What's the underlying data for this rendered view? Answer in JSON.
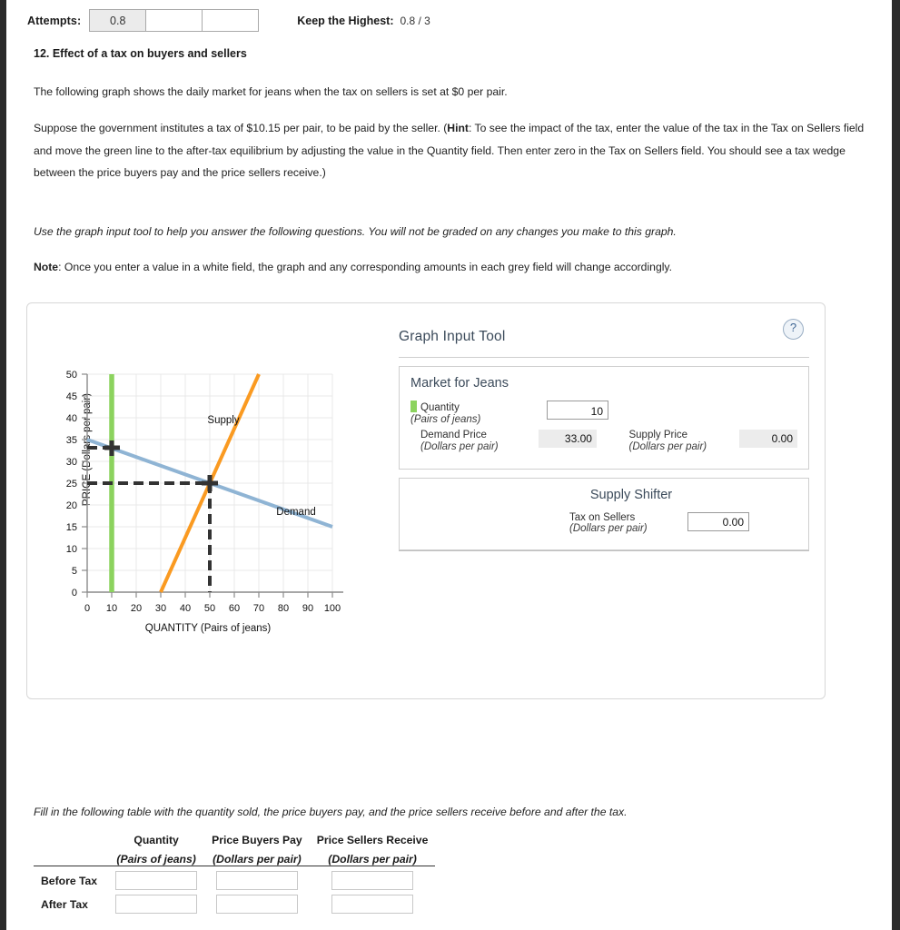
{
  "header": {
    "attempts_label": "Attempts:",
    "attempt_values": [
      "0.8",
      "",
      ""
    ],
    "keep_highest_label": "Keep the Highest:",
    "keep_highest_value": "0.8 / 3"
  },
  "question": {
    "number_title": "12. Effect of a tax on buyers and sellers",
    "p1": "The following graph shows the daily market for jeans when the tax on sellers is set at $0 per pair.",
    "p2_a": "Suppose the government institutes a tax of $10.15 per pair, to be paid by the seller. (",
    "p2_hint": "Hint",
    "p2_b": ": To see the impact of the tax, enter the value of the tax in the Tax on Sellers field and move the green line to the after-tax equilibrium by adjusting the value in the Quantity field. Then enter zero in the Tax on Sellers field. You should see a tax wedge between the price buyers pay and the price sellers receive.)",
    "p3": "Use the graph input tool to help you answer the following questions. You will not be graded on any changes you make to this graph.",
    "p4_note": "Note",
    "p4_rest": ": Once you enter a value in a white field, the graph and any corresponding amounts in each grey field will change accordingly."
  },
  "graph_tool": {
    "title": "Graph Input Tool",
    "help_glyph": "?",
    "market_section_title": "Market for Jeans",
    "quantity_label": "Quantity",
    "quantity_unit": "(Pairs of jeans)",
    "quantity_value": "10",
    "demand_price_label": "Demand Price",
    "demand_price_unit": "(Dollars per pair)",
    "demand_price_value": "33.00",
    "supply_price_label": "Supply Price",
    "supply_price_unit": "(Dollars per pair)",
    "supply_price_value": "0.00",
    "shifter_section_title": "Supply Shifter",
    "tax_label": "Tax on Sellers",
    "tax_unit": "(Dollars per pair)",
    "tax_value": "0.00",
    "swatch_color": "#8CD35E"
  },
  "chart_data": {
    "type": "line",
    "title": "",
    "xlabel": "QUANTITY (Pairs of jeans)",
    "ylabel": "PRICE (Dollars per pair)",
    "xlim": [
      0,
      100
    ],
    "ylim": [
      0,
      50
    ],
    "xticks": [
      0,
      10,
      20,
      30,
      40,
      50,
      60,
      70,
      80,
      90,
      100
    ],
    "yticks": [
      0,
      5,
      10,
      15,
      20,
      25,
      30,
      35,
      40,
      45,
      50
    ],
    "grid": true,
    "legend": "inline-labels",
    "series": [
      {
        "name": "Demand",
        "color": "#8FB4D4",
        "label": "Demand",
        "label_at": [
          78,
          20
        ],
        "points": [
          [
            0,
            35
          ],
          [
            100,
            15
          ]
        ]
      },
      {
        "name": "Supply",
        "color": "#FA9A21",
        "label": "Supply",
        "label_at": [
          47,
          41
        ],
        "points": [
          [
            30,
            0
          ],
          [
            70,
            50
          ]
        ]
      },
      {
        "name": "Quantity line",
        "color": "#8CD35E",
        "label": "",
        "points": [
          [
            10,
            0
          ],
          [
            10,
            50
          ]
        ]
      }
    ],
    "annotations": [
      {
        "type": "cross-marker",
        "at": [
          50,
          25
        ],
        "color": "#333333"
      },
      {
        "type": "cross-marker",
        "at": [
          10,
          33
        ],
        "color": "#333333"
      },
      {
        "type": "dashed-h",
        "from": [
          0,
          25
        ],
        "to": [
          50,
          25
        ],
        "color": "#333333"
      },
      {
        "type": "dashed-v",
        "from": [
          50,
          0
        ],
        "to": [
          50,
          25
        ],
        "color": "#333333"
      },
      {
        "type": "dashed-h",
        "from": [
          0,
          33
        ],
        "to": [
          10,
          33
        ],
        "color": "#333333"
      }
    ]
  },
  "table": {
    "intro": "Fill in the following table with the quantity sold, the price buyers pay, and the price sellers receive before and after the tax.",
    "columns": [
      {
        "title": "Quantity",
        "unit": "(Pairs of jeans)"
      },
      {
        "title": "Price Buyers Pay",
        "unit": "(Dollars per pair)"
      },
      {
        "title": "Price Sellers Receive",
        "unit": "(Dollars per pair)"
      }
    ],
    "rows": [
      {
        "label": "Before Tax",
        "values": [
          "",
          "",
          ""
        ]
      },
      {
        "label": "After Tax",
        "values": [
          "",
          "",
          ""
        ]
      }
    ]
  }
}
